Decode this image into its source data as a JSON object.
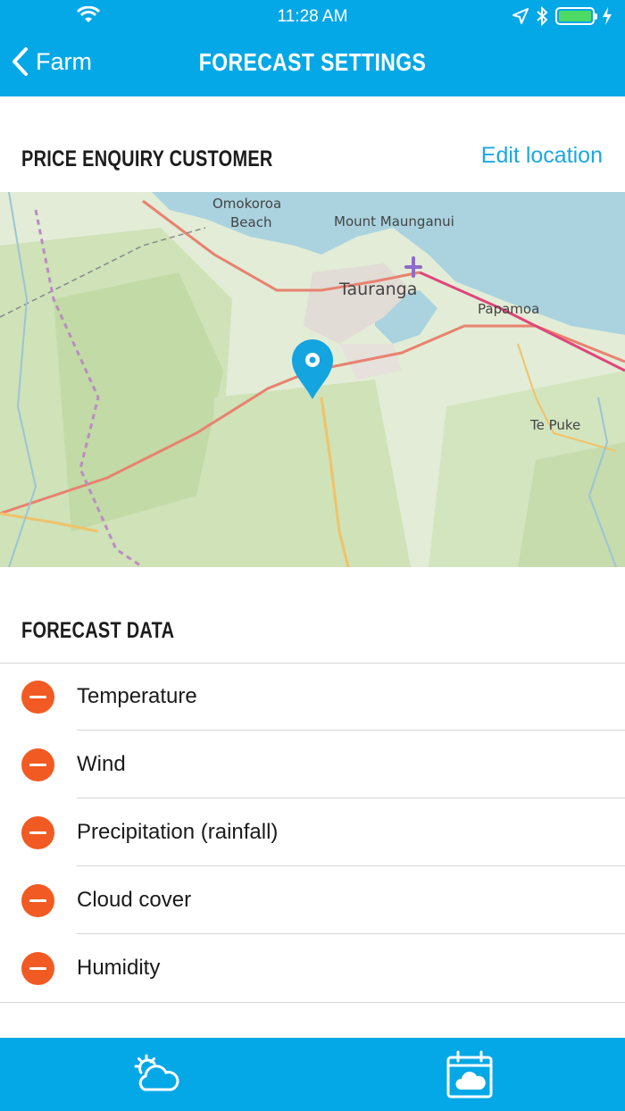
{
  "status_bar": {
    "time": "11:28 AM",
    "icons": [
      "wifi-icon",
      "location-arrow-icon",
      "bluetooth-icon",
      "battery-icon",
      "charging-bolt-icon"
    ]
  },
  "nav": {
    "back_label": "Farm",
    "title": "FORECAST SETTINGS"
  },
  "location": {
    "heading": "PRICE ENQUIRY CUSTOMER",
    "edit_label": "Edit location"
  },
  "map": {
    "labels": {
      "omokoroa": "Omokoroa",
      "beach": "Beach",
      "mount": "Mount Maunganui",
      "tauranga": "Tauranga",
      "papamoa": "Papamoa",
      "tepuke": "Te Puke"
    },
    "pin_color": "#14a4df"
  },
  "forecast": {
    "heading": "FORECAST DATA",
    "items": [
      {
        "label": "Temperature"
      },
      {
        "label": "Wind"
      },
      {
        "label": "Precipitation (rainfall)"
      },
      {
        "label": "Cloud cover"
      },
      {
        "label": "Humidity"
      }
    ]
  },
  "tabs": [
    {
      "icon": "weather-sun-cloud-icon"
    },
    {
      "icon": "calendar-cloud-icon"
    }
  ],
  "colors": {
    "accent": "#05a8e6",
    "remove": "#f15a22",
    "link": "#1ba7e3"
  }
}
